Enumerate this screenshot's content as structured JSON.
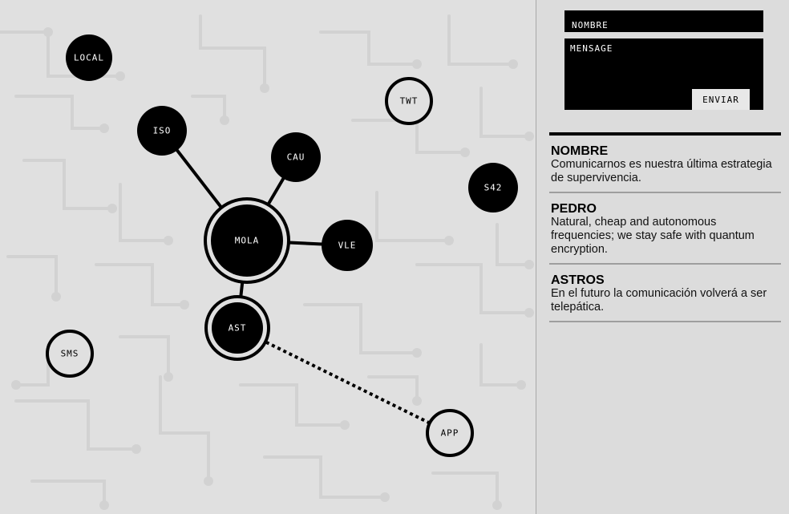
{
  "network": {
    "nodes": [
      {
        "id": "local",
        "label": "LOCAL",
        "style": "filled"
      },
      {
        "id": "iso",
        "label": "ISO",
        "style": "filled"
      },
      {
        "id": "cau",
        "label": "CAU",
        "style": "filled"
      },
      {
        "id": "mola",
        "label": "MOLA",
        "style": "filled-ringed"
      },
      {
        "id": "vle",
        "label": "VLE",
        "style": "filled"
      },
      {
        "id": "ast",
        "label": "AST",
        "style": "filled-ringed"
      },
      {
        "id": "twt",
        "label": "TWT",
        "style": "outline"
      },
      {
        "id": "s42",
        "label": "S42",
        "style": "filled"
      },
      {
        "id": "sms",
        "label": "SMS",
        "style": "outline"
      },
      {
        "id": "app",
        "label": "APP",
        "style": "outline"
      }
    ],
    "links": [
      {
        "from": "iso",
        "to": "mola",
        "style": "solid"
      },
      {
        "from": "cau",
        "to": "mola",
        "style": "solid"
      },
      {
        "from": "vle",
        "to": "mola",
        "style": "solid"
      },
      {
        "from": "ast",
        "to": "mola",
        "style": "solid"
      },
      {
        "from": "ast",
        "to": "app",
        "style": "dotted"
      }
    ],
    "colors": {
      "node": "#000000",
      "label_on_filled": "#ffffff",
      "label_on_outline": "#000000",
      "circuit": "#d2d2d2"
    }
  },
  "form": {
    "name_placeholder": "NOMBRE",
    "message_placeholder": "MENSAGE",
    "send_label": "ENVIAR"
  },
  "messages": [
    {
      "author": "NOMBRE",
      "text": "Comunicarnos es nuestra última estrategia de supervivencia."
    },
    {
      "author": "PEDRO",
      "text": "Natural, cheap and autonomous frequencies; we stay safe with quantum encryption."
    },
    {
      "author": "ASTROS",
      "text": "En el futuro la comunicación volverá a ser telepática."
    }
  ]
}
